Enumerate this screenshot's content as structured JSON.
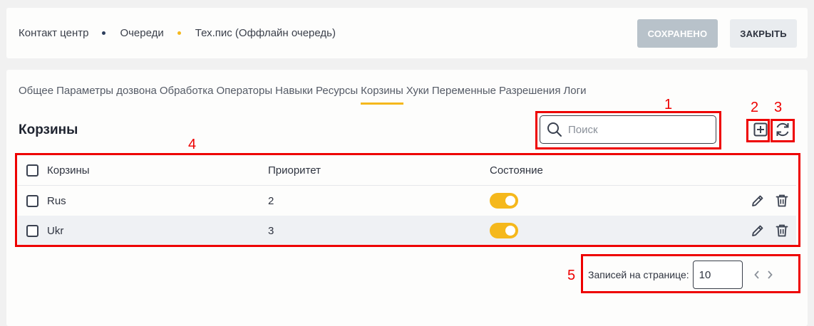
{
  "breadcrumb": {
    "items": [
      "Контакт центр",
      "Очереди",
      "Тех.пис (Оффлайн очередь)"
    ],
    "dot_colors": [
      "#2c3e5c",
      "#f5b81c"
    ]
  },
  "header_buttons": {
    "saved_label": "СОХРАНЕНО",
    "close_label": "ЗАКРЫТЬ"
  },
  "tabs": [
    {
      "label": "Общее"
    },
    {
      "label": "Параметры дозвона"
    },
    {
      "label": "Обработка"
    },
    {
      "label": "Операторы"
    },
    {
      "label": "Навыки"
    },
    {
      "label": "Ресурсы"
    },
    {
      "label": "Корзины",
      "active": true
    },
    {
      "label": "Хуки"
    },
    {
      "label": "Переменные"
    },
    {
      "label": "Разрешения"
    },
    {
      "label": "Логи"
    }
  ],
  "section": {
    "title": "Корзины"
  },
  "search": {
    "placeholder": "Поиск",
    "value": ""
  },
  "table": {
    "columns": [
      "Корзины",
      "Приоритет",
      "Состояние"
    ],
    "rows": [
      {
        "name": "Rus",
        "priority": "2",
        "enabled": true
      },
      {
        "name": "Ukr",
        "priority": "3",
        "enabled": true
      }
    ]
  },
  "pagination": {
    "label": "Записей на странице:",
    "per_page": "10"
  },
  "annotations": [
    "1",
    "2",
    "3",
    "4",
    "5"
  ],
  "colors": {
    "accent": "#f5b81c",
    "annotation": "#ee0000",
    "saved_button": "#b8c2ca"
  },
  "icons": [
    "search-icon",
    "add-icon",
    "refresh-icon",
    "edit-icon",
    "delete-icon",
    "chevron-left-icon",
    "chevron-right-icon"
  ]
}
